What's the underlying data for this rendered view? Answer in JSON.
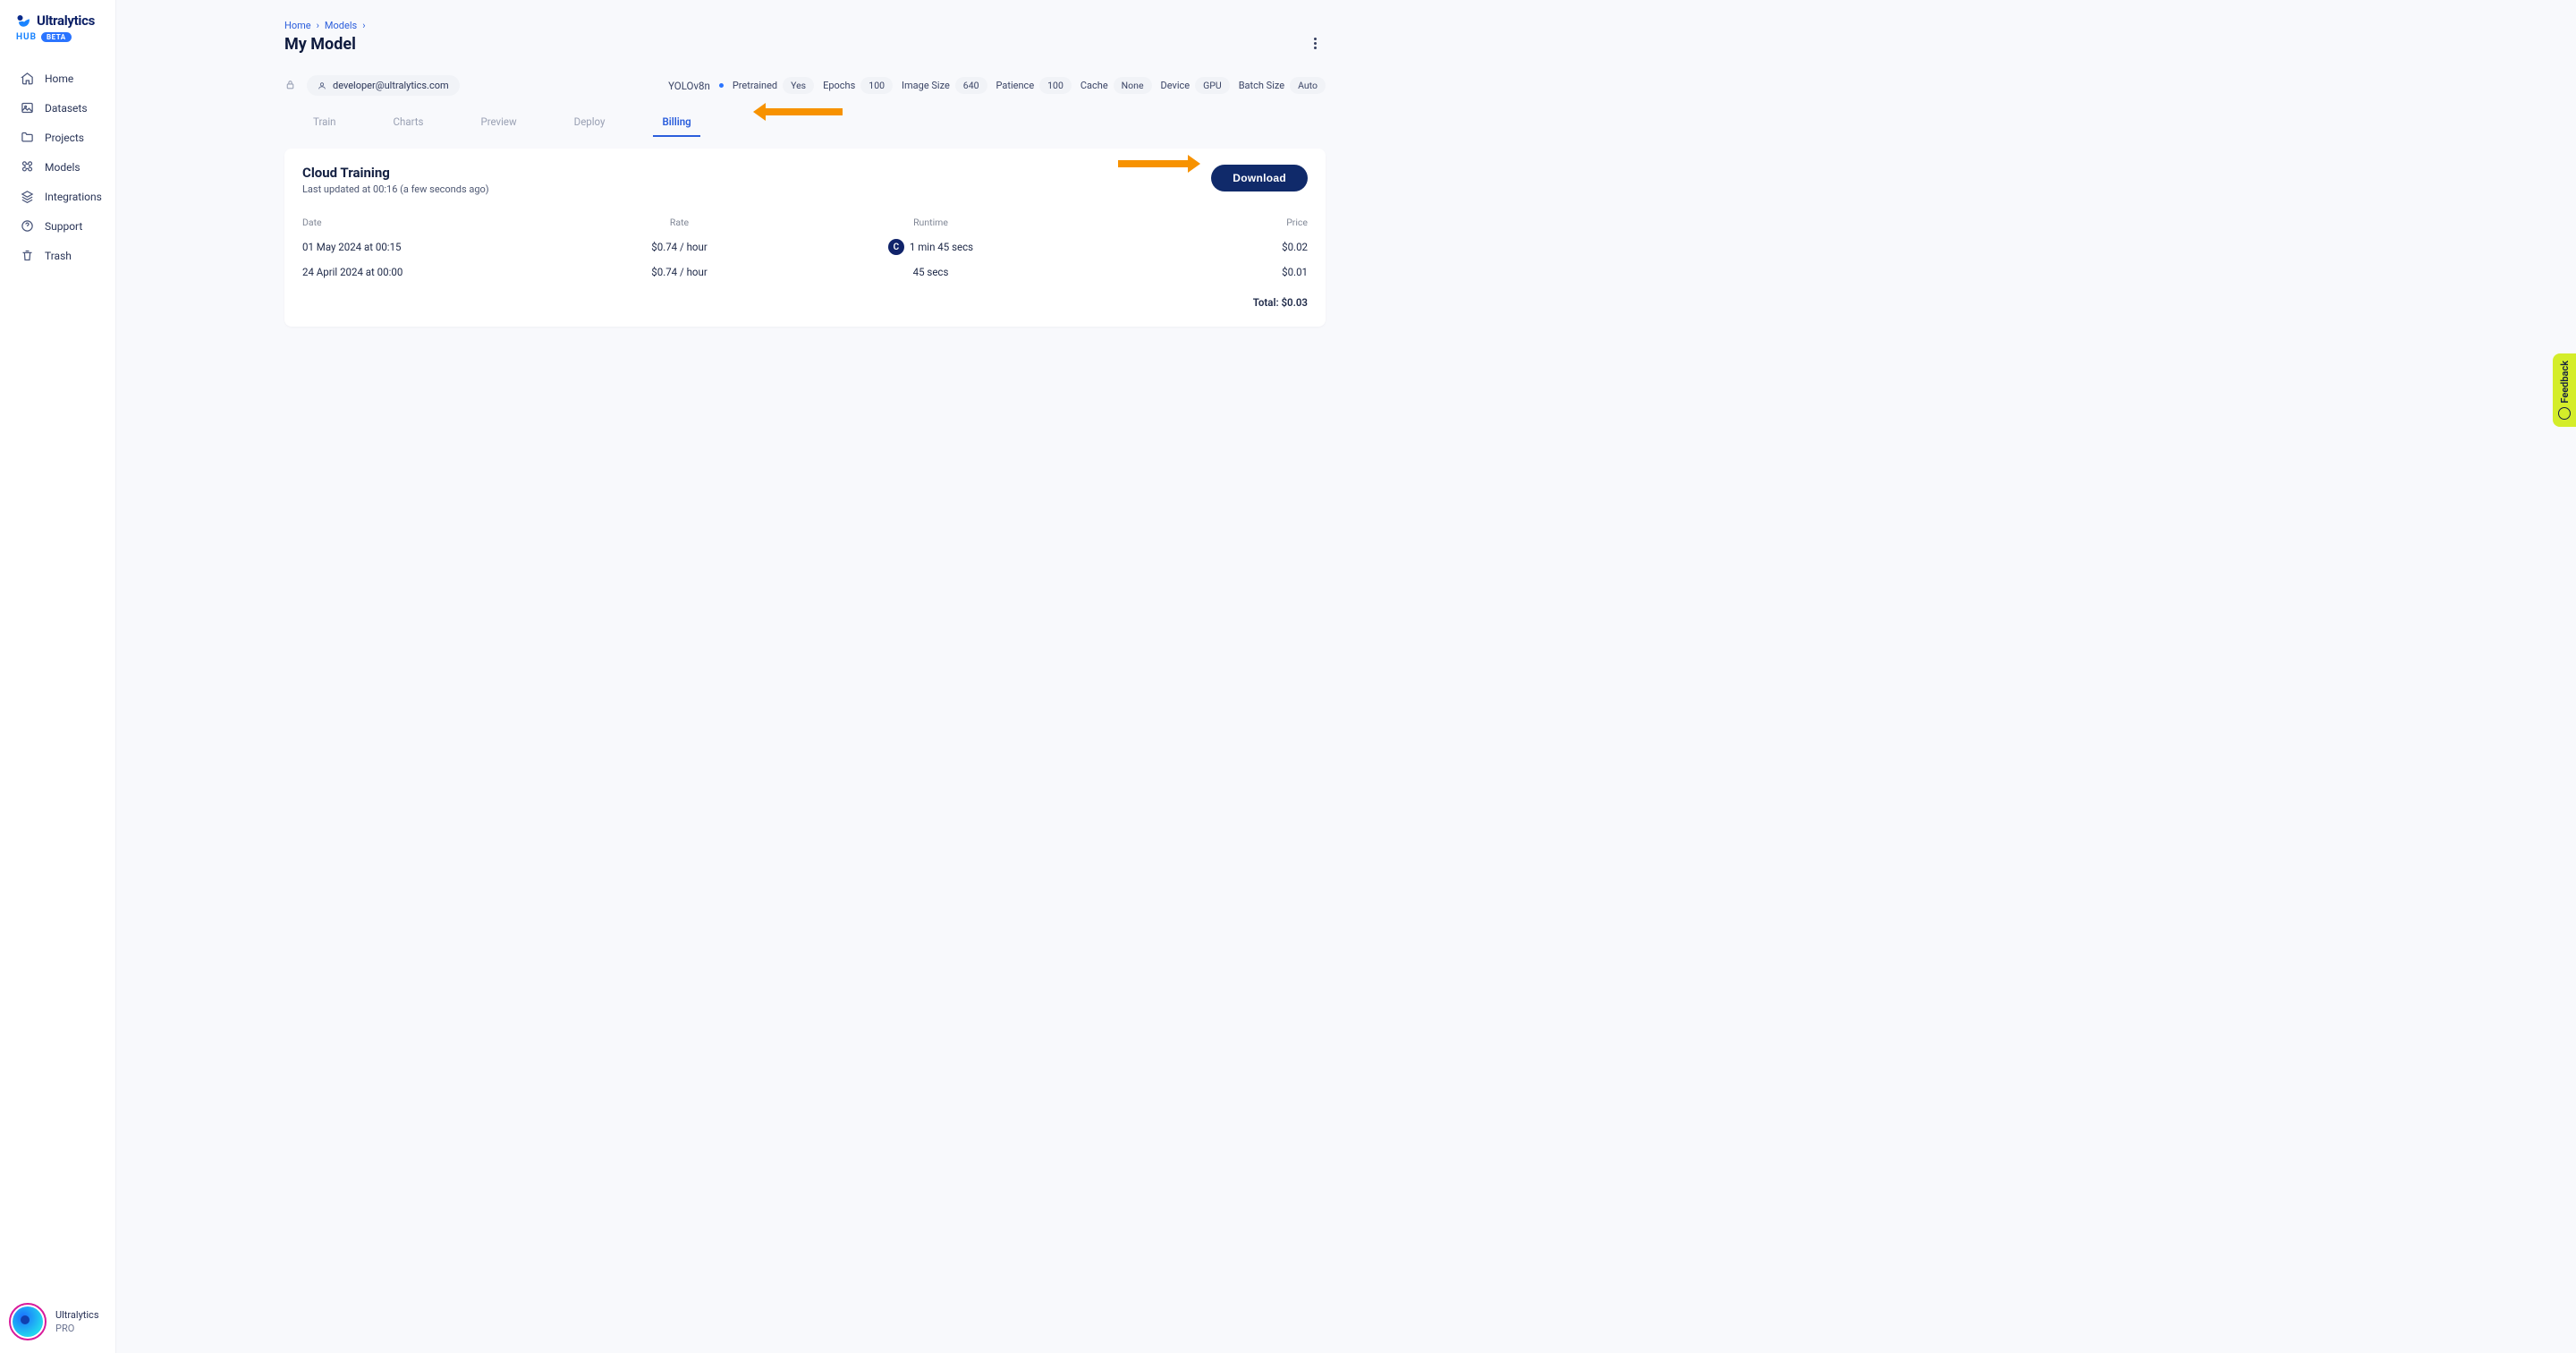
{
  "logo": {
    "brand": "Ultralytics",
    "sub": "HUB",
    "badge": "BETA"
  },
  "sidebar": {
    "items": [
      {
        "label": "Home"
      },
      {
        "label": "Datasets"
      },
      {
        "label": "Projects"
      },
      {
        "label": "Models"
      },
      {
        "label": "Integrations"
      },
      {
        "label": "Support"
      },
      {
        "label": "Trash"
      }
    ]
  },
  "footer": {
    "name": "Ultralytics",
    "plan": "PRO"
  },
  "breadcrumb": {
    "home": "Home",
    "models": "Models"
  },
  "page_title": "My Model",
  "owner_pill": "developer@ultralytics.com",
  "specs": {
    "model": "YOLOv8n",
    "pretrained_label": "Pretrained",
    "pretrained_value": "Yes",
    "epochs_label": "Epochs",
    "epochs_value": "100",
    "image_size_label": "Image Size",
    "image_size_value": "640",
    "patience_label": "Patience",
    "patience_value": "100",
    "cache_label": "Cache",
    "cache_value": "None",
    "device_label": "Device",
    "device_value": "GPU",
    "batch_label": "Batch Size",
    "batch_value": "Auto"
  },
  "tabs": {
    "train": "Train",
    "charts": "Charts",
    "preview": "Preview",
    "deploy": "Deploy",
    "billing": "Billing"
  },
  "card": {
    "title": "Cloud Training",
    "subtitle": "Last updated at 00:16 (a few seconds ago)",
    "download": "Download"
  },
  "table": {
    "headers": {
      "date": "Date",
      "rate": "Rate",
      "runtime": "Runtime",
      "price": "Price"
    },
    "rows": [
      {
        "date": "01 May 2024 at 00:15",
        "rate": "$0.74 / hour",
        "runtime": "1 min 45 secs",
        "price": "$0.02",
        "badge": "C"
      },
      {
        "date": "24 April 2024 at 00:00",
        "rate": "$0.74 / hour",
        "runtime": "45 secs",
        "price": "$0.01"
      }
    ],
    "total": "Total: $0.03"
  },
  "feedback": "Feedback"
}
